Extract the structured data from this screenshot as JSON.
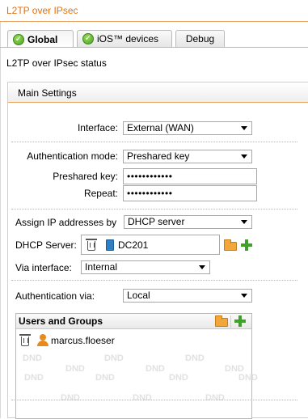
{
  "header": {
    "title": "L2TP over IPsec"
  },
  "tabs": [
    {
      "label": "Global",
      "check": "✓",
      "active": true
    },
    {
      "label": "iOS™ devices",
      "check": "✓",
      "active": false
    },
    {
      "label": "Debug",
      "active": false
    }
  ],
  "status_line": "L2TP over IPsec status",
  "panel": {
    "title": "Main Settings",
    "interface": {
      "label": "Interface:",
      "value": "External (WAN)"
    },
    "auth_mode": {
      "label": "Authentication mode:",
      "value": "Preshared key"
    },
    "preshared_key": {
      "label": "Preshared key:",
      "value": "••••••••••••"
    },
    "repeat": {
      "label": "Repeat:",
      "value": "••••••••••••"
    },
    "assign_ip": {
      "label": "Assign IP addresses by",
      "value": "DHCP server"
    },
    "dhcp_server": {
      "label": "DHCP Server:",
      "value": "DC201"
    },
    "via_interface": {
      "label": "Via interface:",
      "value": "Internal"
    },
    "auth_via": {
      "label": "Authentication via:",
      "value": "Local"
    }
  },
  "users_groups": {
    "title": "Users and Groups",
    "items": [
      {
        "name": "marcus.floeser"
      }
    ],
    "watermark": "DND"
  },
  "colors": {
    "accent": "#e8700a",
    "accent_rule": "#e8a25d",
    "success_green": "#4aa024",
    "folder_orange": "#f1a73b",
    "user_orange": "#e88b1e",
    "server_blue": "#2f7fc2"
  }
}
